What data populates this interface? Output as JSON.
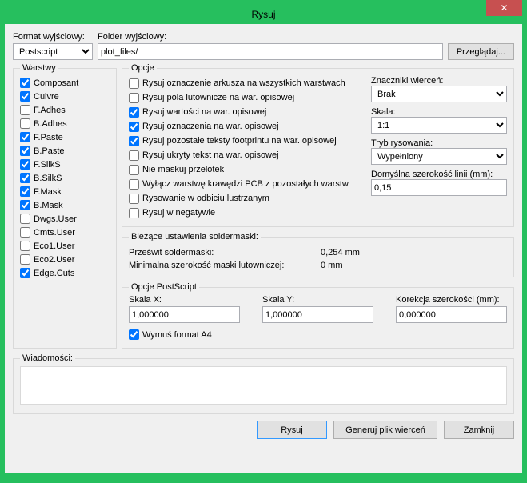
{
  "title": "Rysuj",
  "close": "✕",
  "labels": {
    "format": "Format wyjściowy:",
    "folder": "Folder wyjściowy:",
    "browse": "Przeglądaj...",
    "layers": "Warstwy",
    "options": "Opcje",
    "drillMarks": "Znaczniki wierceń:",
    "scale": "Skala:",
    "plotMode": "Tryb rysowania:",
    "defaultLineWidth": "Domyślna szerokość linii (mm):",
    "solderMask": "Bieżące ustawienia soldermaski:",
    "clearance": "Prześwit soldermaski:",
    "minWidth": "Minimalna szerokość maski lutowniczej:",
    "psOptions": "Opcje PostScript",
    "scaleX": "Skala X:",
    "scaleY": "Skala Y:",
    "widthCorr": "Korekcja szerokości (mm):",
    "forceA4": "Wymuś format A4",
    "messages": "Wiadomości:",
    "plot": "Rysuj",
    "genDrill": "Generuj plik wierceń",
    "close2": "Zamknij"
  },
  "format": "Postscript",
  "folder": "plot_files/",
  "layers": [
    {
      "label": "Composant",
      "checked": true
    },
    {
      "label": "Cuivre",
      "checked": true
    },
    {
      "label": "F.Adhes",
      "checked": false
    },
    {
      "label": "B.Adhes",
      "checked": false
    },
    {
      "label": "F.Paste",
      "checked": true
    },
    {
      "label": "B.Paste",
      "checked": true
    },
    {
      "label": "F.SilkS",
      "checked": true
    },
    {
      "label": "B.SilkS",
      "checked": true
    },
    {
      "label": "F.Mask",
      "checked": true
    },
    {
      "label": "B.Mask",
      "checked": true
    },
    {
      "label": "Dwgs.User",
      "checked": false
    },
    {
      "label": "Cmts.User",
      "checked": false
    },
    {
      "label": "Eco1.User",
      "checked": false
    },
    {
      "label": "Eco2.User",
      "checked": false
    },
    {
      "label": "Edge.Cuts",
      "checked": true
    }
  ],
  "opts": [
    {
      "label": "Rysuj oznaczenie arkusza na wszystkich warstwach",
      "checked": false
    },
    {
      "label": "Rysuj pola lutownicze na war. opisowej",
      "checked": false
    },
    {
      "label": "Rysuj wartości na war. opisowej",
      "checked": true
    },
    {
      "label": "Rysuj oznaczenia na war. opisowej",
      "checked": true
    },
    {
      "label": "Rysuj pozostałe teksty footprintu na war. opisowej",
      "checked": true
    },
    {
      "label": "Rysuj ukryty tekst na war. opisowej",
      "checked": false
    },
    {
      "label": "Nie maskuj przelotek",
      "checked": false
    },
    {
      "label": "Wyłącz warstwę krawędzi PCB z pozostałych warstw",
      "checked": false
    },
    {
      "label": "Rysowanie w odbiciu lustrzanym",
      "checked": false
    },
    {
      "label": "Rysuj w negatywie",
      "checked": false
    }
  ],
  "drillMarks": "Brak",
  "scale": "1:1",
  "plotMode": "Wypełniony",
  "lineWidth": "0,15",
  "clearanceVal": "0,254 mm",
  "minWidthVal": "0 mm",
  "scaleX": "1,000000",
  "scaleY": "1,000000",
  "widthCorr": "0,000000",
  "forceA4": true
}
